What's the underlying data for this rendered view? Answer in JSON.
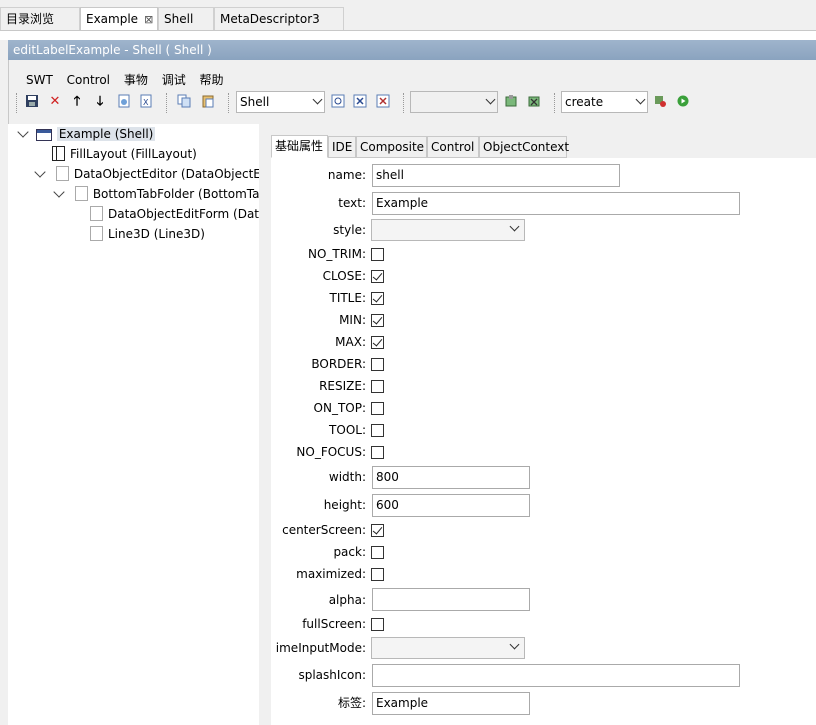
{
  "top_tabs": [
    {
      "label": "目录浏览"
    },
    {
      "label": "Example"
    },
    {
      "label": "Shell"
    },
    {
      "label": "MetaDescriptor3"
    }
  ],
  "window_title": "editLabelExample - Shell ( Shell )",
  "menu": [
    "SWT",
    "Control",
    "事物",
    "调试",
    "帮助"
  ],
  "toolbar": {
    "shell_combo": "Shell",
    "empty_combo": "",
    "action_combo": "create"
  },
  "tree": [
    {
      "label": "Example (Shell)"
    },
    {
      "label": "FillLayout (FillLayout)"
    },
    {
      "label": "DataObjectEditor (DataObjectEd"
    },
    {
      "label": "BottomTabFolder (BottomTa"
    },
    {
      "label": "DataObjectEditForm (Data"
    },
    {
      "label": "Line3D (Line3D)"
    }
  ],
  "panel_tabs": [
    "基础属性",
    "IDE",
    "Composite",
    "Control",
    "ObjectContext"
  ],
  "fields": {
    "name": {
      "label": "name:",
      "value": "shell"
    },
    "text": {
      "label": "text:",
      "value": "Example"
    },
    "style": {
      "label": "style:",
      "value": ""
    },
    "no_trim": {
      "label": "NO_TRIM:",
      "checked": false
    },
    "close": {
      "label": "CLOSE:",
      "checked": true
    },
    "title": {
      "label": "TITLE:",
      "checked": true
    },
    "min": {
      "label": "MIN:",
      "checked": true
    },
    "max": {
      "label": "MAX:",
      "checked": true
    },
    "border": {
      "label": "BORDER:",
      "checked": false
    },
    "resize": {
      "label": "RESIZE:",
      "checked": false
    },
    "on_top": {
      "label": "ON_TOP:",
      "checked": false
    },
    "tool": {
      "label": "TOOL:",
      "checked": false
    },
    "no_focus": {
      "label": "NO_FOCUS:",
      "checked": false
    },
    "width": {
      "label": "width:",
      "value": "800"
    },
    "height": {
      "label": "height:",
      "value": "600"
    },
    "center_screen": {
      "label": "centerScreen:",
      "checked": true
    },
    "pack": {
      "label": "pack:",
      "checked": false
    },
    "maximized": {
      "label": "maximized:",
      "checked": false
    },
    "alpha": {
      "label": "alpha:",
      "value": ""
    },
    "full_screen": {
      "label": "fullScreen:",
      "checked": false
    },
    "ime_input_mode": {
      "label": "imeInputMode:",
      "value": ""
    },
    "splash_icon": {
      "label": "splashIcon:",
      "value": ""
    },
    "biaoqian": {
      "label": "标签:",
      "value": "Example"
    }
  }
}
